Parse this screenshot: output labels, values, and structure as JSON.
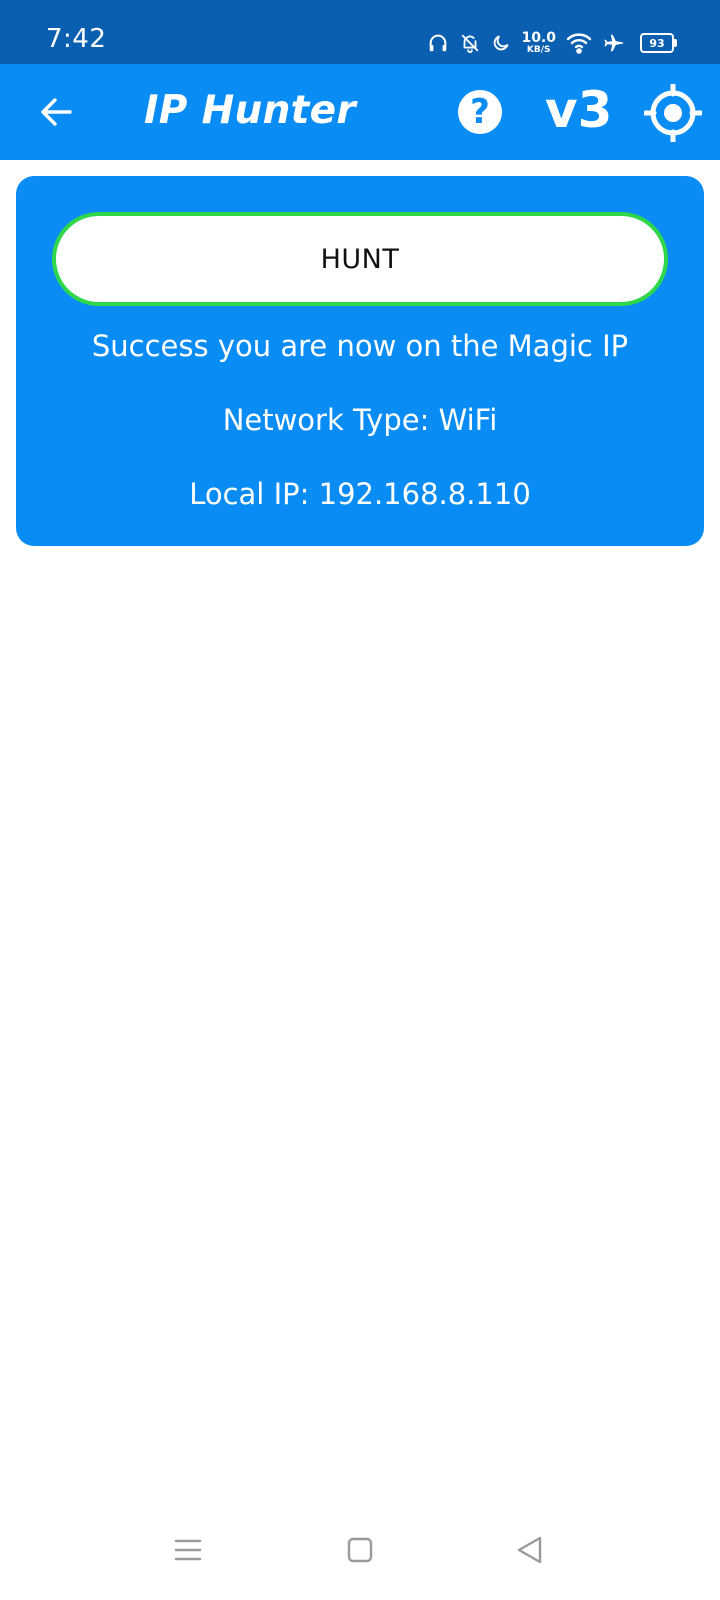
{
  "status_bar": {
    "time": "7:42",
    "speed_value": "10.0",
    "speed_unit": "KB/S",
    "battery": "93",
    "icons": [
      "headphones-icon",
      "bell-off-icon",
      "moon-icon",
      "speed-indicator",
      "wifi-icon",
      "airplane-icon",
      "battery-icon"
    ]
  },
  "app_bar": {
    "title": "IP Hunter",
    "help_label": "?",
    "version_label": "v3",
    "icons": [
      "back-arrow-icon",
      "help-icon",
      "target-icon"
    ]
  },
  "card": {
    "hunt_label": "HUNT",
    "status_message": "Success you are now on the Magic IP",
    "network_type": "Network Type: WiFi",
    "local_ip": "Local IP: 192.168.8.110"
  },
  "nav_bar": {
    "icons": [
      "menu-icon",
      "home-square-icon",
      "back-triangle-icon"
    ]
  },
  "colors": {
    "status_bar_bg": "#0a5fb1",
    "app_bar_bg": "#0a8cf5",
    "card_bg": "#0a8cf5",
    "hunt_border": "#2fd84a",
    "nav_icon": "#9a9a9a"
  }
}
